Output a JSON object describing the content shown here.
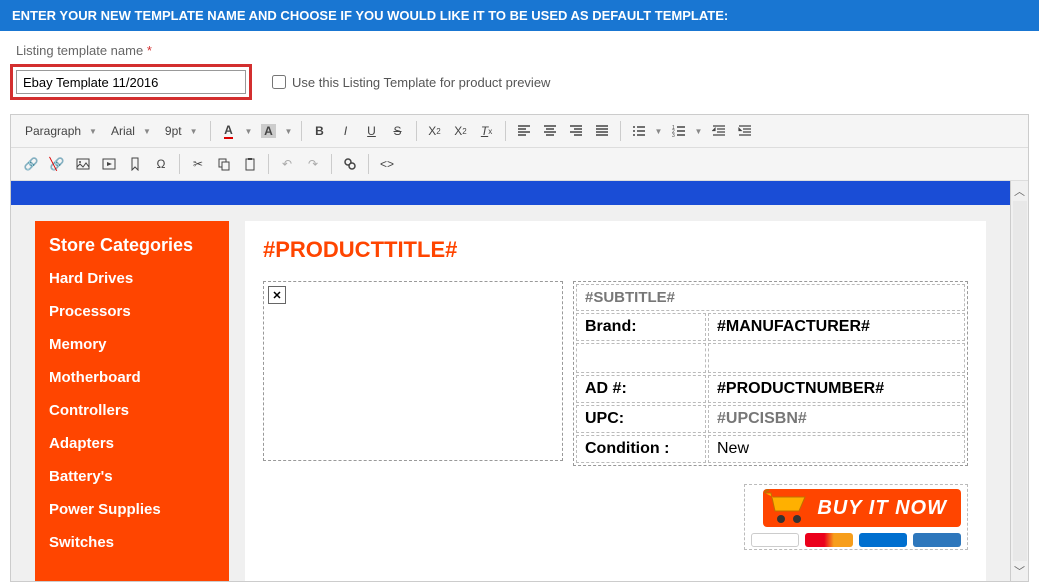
{
  "banner": "ENTER YOUR NEW TEMPLATE NAME AND CHOOSE IF YOU WOULD LIKE IT TO BE USED AS DEFAULT TEMPLATE:",
  "form": {
    "label": "Listing template name",
    "required_mark": "*",
    "value": "Ebay Template 11/2016",
    "checkbox_label": "Use this Listing Template for product preview"
  },
  "toolbar": {
    "paragraph": "Paragraph",
    "font": "Arial",
    "size": "9pt"
  },
  "template": {
    "sidebar_title": "Store Categories",
    "categories": [
      "Hard Drives",
      "Processors",
      "Memory",
      "Motherboard",
      "Controllers",
      "Adapters",
      "Battery's",
      "Power Supplies",
      "Switches"
    ],
    "product_title": "#PRODUCTTITLE#",
    "subtitle": "#SUBTITLE#",
    "rows": [
      {
        "label": "Brand:",
        "value": "#MANUFACTURER#",
        "ph": false
      },
      {
        "label": "AD #:",
        "value": "#PRODUCTNUMBER#",
        "ph": false
      },
      {
        "label": "UPC:",
        "value": "#UPCISBN#",
        "ph": true
      },
      {
        "label": "Condition :",
        "value": "New",
        "ph": false
      }
    ],
    "buy_label": "BUY IT NOW"
  }
}
